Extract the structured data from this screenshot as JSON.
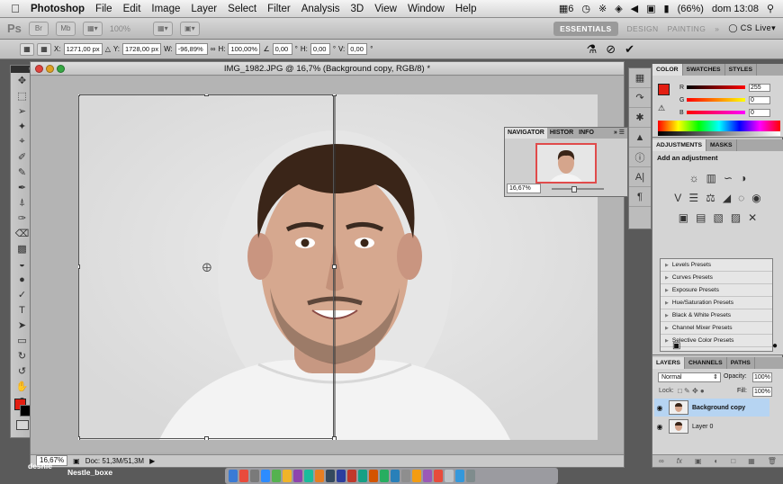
{
  "menubar": {
    "app_name": "Photoshop",
    "items": [
      "File",
      "Edit",
      "Image",
      "Layer",
      "Select",
      "Filter",
      "Analysis",
      "3D",
      "View",
      "Window",
      "Help"
    ],
    "status_extra": "6",
    "battery": "(66%)",
    "clock": "dom 13:08"
  },
  "appbar": {
    "logo": "Ps",
    "zoom": "100%",
    "workspaces": [
      "ESSENTIALS",
      "DESIGN",
      "PAINTING"
    ],
    "more": "»",
    "cslive": "CS Live"
  },
  "options": {
    "x_label": "X:",
    "x_value": "1271,00 px",
    "y_label": "Y:",
    "y_value": "1728,00 px",
    "w_label": "W:",
    "w_value": "-96,89%",
    "h_label": "H:",
    "h_value": "100,00%",
    "angle_value": "0,00",
    "angle_unit": "°",
    "hskew_label": "H:",
    "hskew_value": "0,00",
    "vskew_label": "V:",
    "vskew_value": "0,00",
    "skew_unit": "°"
  },
  "document": {
    "title": "IMG_1982.JPG @ 16,7% (Background copy, RGB/8) *",
    "zoom": "16,67%",
    "doc_info": "Doc: 51,3M/51,3M"
  },
  "navigator": {
    "tabs": [
      "NAVIGATOR",
      "HISTOR",
      "INFO"
    ],
    "zoom": "16,67%"
  },
  "color_panel": {
    "tabs": [
      "COLOR",
      "SWATCHES",
      "STYLES"
    ],
    "r_label": "R",
    "r_value": "255",
    "g_label": "G",
    "g_value": "0",
    "b_label": "B",
    "b_value": "0",
    "fg_color": "#ff0000"
  },
  "adjustments": {
    "tabs": [
      "ADJUSTMENTS",
      "MASKS"
    ],
    "heading": "Add an adjustment",
    "presets": [
      "Levels Presets",
      "Curves Presets",
      "Exposure Presets",
      "Hue/Saturation Presets",
      "Black & White Presets",
      "Channel Mixer Presets",
      "Selective Color Presets"
    ]
  },
  "layers": {
    "tabs": [
      "LAYERS",
      "CHANNELS",
      "PATHS"
    ],
    "blend_mode": "Normal",
    "opacity_label": "Opacity:",
    "opacity_value": "100%",
    "lock_label": "Lock:",
    "fill_label": "Fill:",
    "fill_value": "100%",
    "items": [
      {
        "name": "Background copy",
        "selected": true
      },
      {
        "name": "Layer 0",
        "selected": false
      }
    ]
  },
  "desktop": {
    "label1": "deshle",
    "label2": "Nestle_boxe"
  }
}
